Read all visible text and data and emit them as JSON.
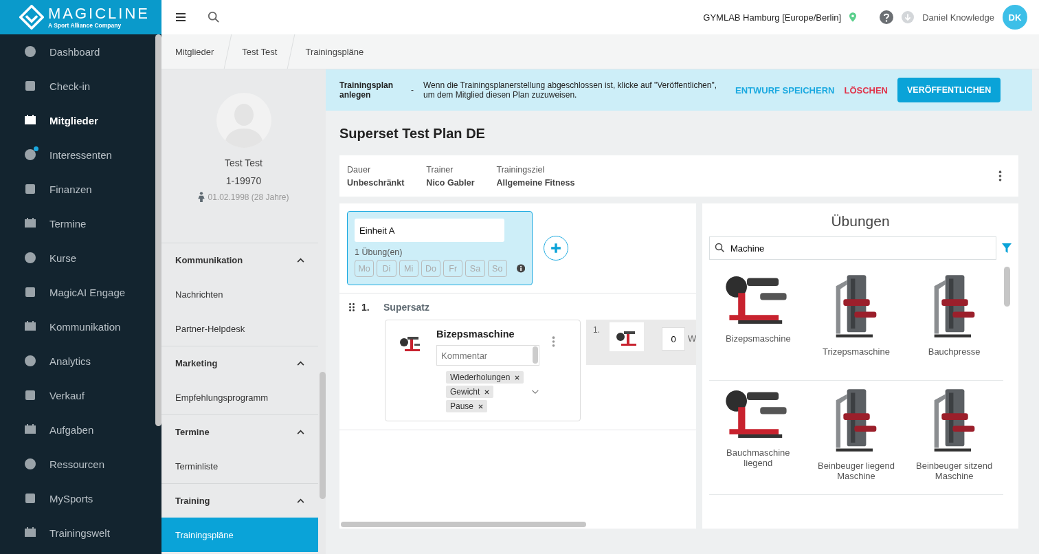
{
  "app": {
    "logo_title": "MAGICLINE",
    "logo_subtitle": "A Sport Alliance Company"
  },
  "topbar": {
    "location": "GYMLAB Hamburg [Europe/Berlin]",
    "user": "Daniel Knowledge",
    "avatar": "DK"
  },
  "sidebar": {
    "items": [
      {
        "label": "Dashboard",
        "selected": false,
        "notification": false
      },
      {
        "label": "Check-in",
        "selected": false,
        "notification": false
      },
      {
        "label": "Mitglieder",
        "selected": true,
        "notification": false
      },
      {
        "label": "Interessenten",
        "selected": false,
        "notification": true
      },
      {
        "label": "Finanzen",
        "selected": false,
        "notification": false
      },
      {
        "label": "Termine",
        "selected": false,
        "notification": false
      },
      {
        "label": "Kurse",
        "selected": false,
        "notification": false
      },
      {
        "label": "MagicAI Engage",
        "selected": false,
        "notification": false
      },
      {
        "label": "Kommunikation",
        "selected": false,
        "notification": false
      },
      {
        "label": "Analytics",
        "selected": false,
        "notification": false
      },
      {
        "label": "Verkauf",
        "selected": false,
        "notification": false
      },
      {
        "label": "Aufgaben",
        "selected": false,
        "notification": false
      },
      {
        "label": "Ressourcen",
        "selected": false,
        "notification": false
      },
      {
        "label": "MySports",
        "selected": false,
        "notification": false
      },
      {
        "label": "Trainingswelt",
        "selected": false,
        "notification": false
      }
    ]
  },
  "breadcrumbs": [
    "Mitglieder",
    "Test Test",
    "Trainingspläne"
  ],
  "member": {
    "name": "Test Test",
    "number": "1-19970",
    "birth": "01.02.1998 (28 Jahre)",
    "sections": [
      {
        "title": "Kommunikation",
        "expanded": true,
        "items": [
          {
            "label": "Nachrichten",
            "selected": false
          },
          {
            "label": "Partner-Helpdesk",
            "selected": false
          }
        ]
      },
      {
        "title": "Marketing",
        "expanded": true,
        "items": [
          {
            "label": "Empfehlungsprogramm",
            "selected": false
          }
        ]
      },
      {
        "title": "Termine",
        "expanded": true,
        "items": [
          {
            "label": "Terminliste",
            "selected": false
          }
        ]
      },
      {
        "title": "Training",
        "expanded": true,
        "items": [
          {
            "label": "Trainingspläne",
            "selected": true
          }
        ]
      }
    ]
  },
  "banner": {
    "title": "Trainingsplan anlegen",
    "separator": "-",
    "text": "Wenn die Trainingsplanerstellung abgeschlossen ist, klicke auf \"Veröffentlichen\", um dem Mitglied diesen Plan zuzuweisen.",
    "buttons": [
      {
        "label": "ENTWURF SPEICHERN",
        "kind": "link"
      },
      {
        "label": "LÖSCHEN",
        "kind": "danger"
      },
      {
        "label": "VERÖFFENTLICHEN",
        "kind": "primary"
      }
    ]
  },
  "plan": {
    "title": "Superset Test Plan DE",
    "details": [
      {
        "label": "Dauer",
        "value": "Unbeschränkt"
      },
      {
        "label": "Trainer",
        "value": "Nico Gabler"
      },
      {
        "label": "Trainingsziel",
        "value": "Allgemeine Fitness"
      }
    ]
  },
  "units": [
    {
      "name": "Einheit A",
      "count": "1 Übung(en)",
      "selected": true,
      "days": [
        {
          "label": "Mo",
          "selected": false
        },
        {
          "label": "Di",
          "selected": false
        },
        {
          "label": "Mi",
          "selected": false
        },
        {
          "label": "Do",
          "selected": false
        },
        {
          "label": "Fr",
          "selected": false
        },
        {
          "label": "Sa",
          "selected": false
        },
        {
          "label": "So",
          "selected": false
        }
      ]
    }
  ],
  "blocks": [
    {
      "number": "1.",
      "title": "Supersatz",
      "exercises": [
        {
          "name": "Bizepsmaschine",
          "comment_placeholder": "Kommentar",
          "tags": [
            "Wiederholungen",
            "Gewicht",
            "Pause"
          ],
          "sets": [
            {
              "number": "1.",
              "value": "0",
              "column_label": "W"
            }
          ]
        }
      ]
    }
  ],
  "library": {
    "title": "Übungen",
    "search": {
      "value": "Machine"
    },
    "items": [
      {
        "name": "Bizepsmaschine",
        "kind": "picture"
      },
      {
        "name": "Trizepsmaschine",
        "kind": "picture"
      },
      {
        "name": "Bauchpresse",
        "kind": "picture"
      },
      {
        "name": "Bauchmaschine liegend",
        "kind": "picture"
      },
      {
        "name": "Beinbeuger liegend Maschine",
        "kind": "picture"
      },
      {
        "name": "Beinbeuger sitzend Maschine",
        "kind": "picture"
      }
    ]
  }
}
